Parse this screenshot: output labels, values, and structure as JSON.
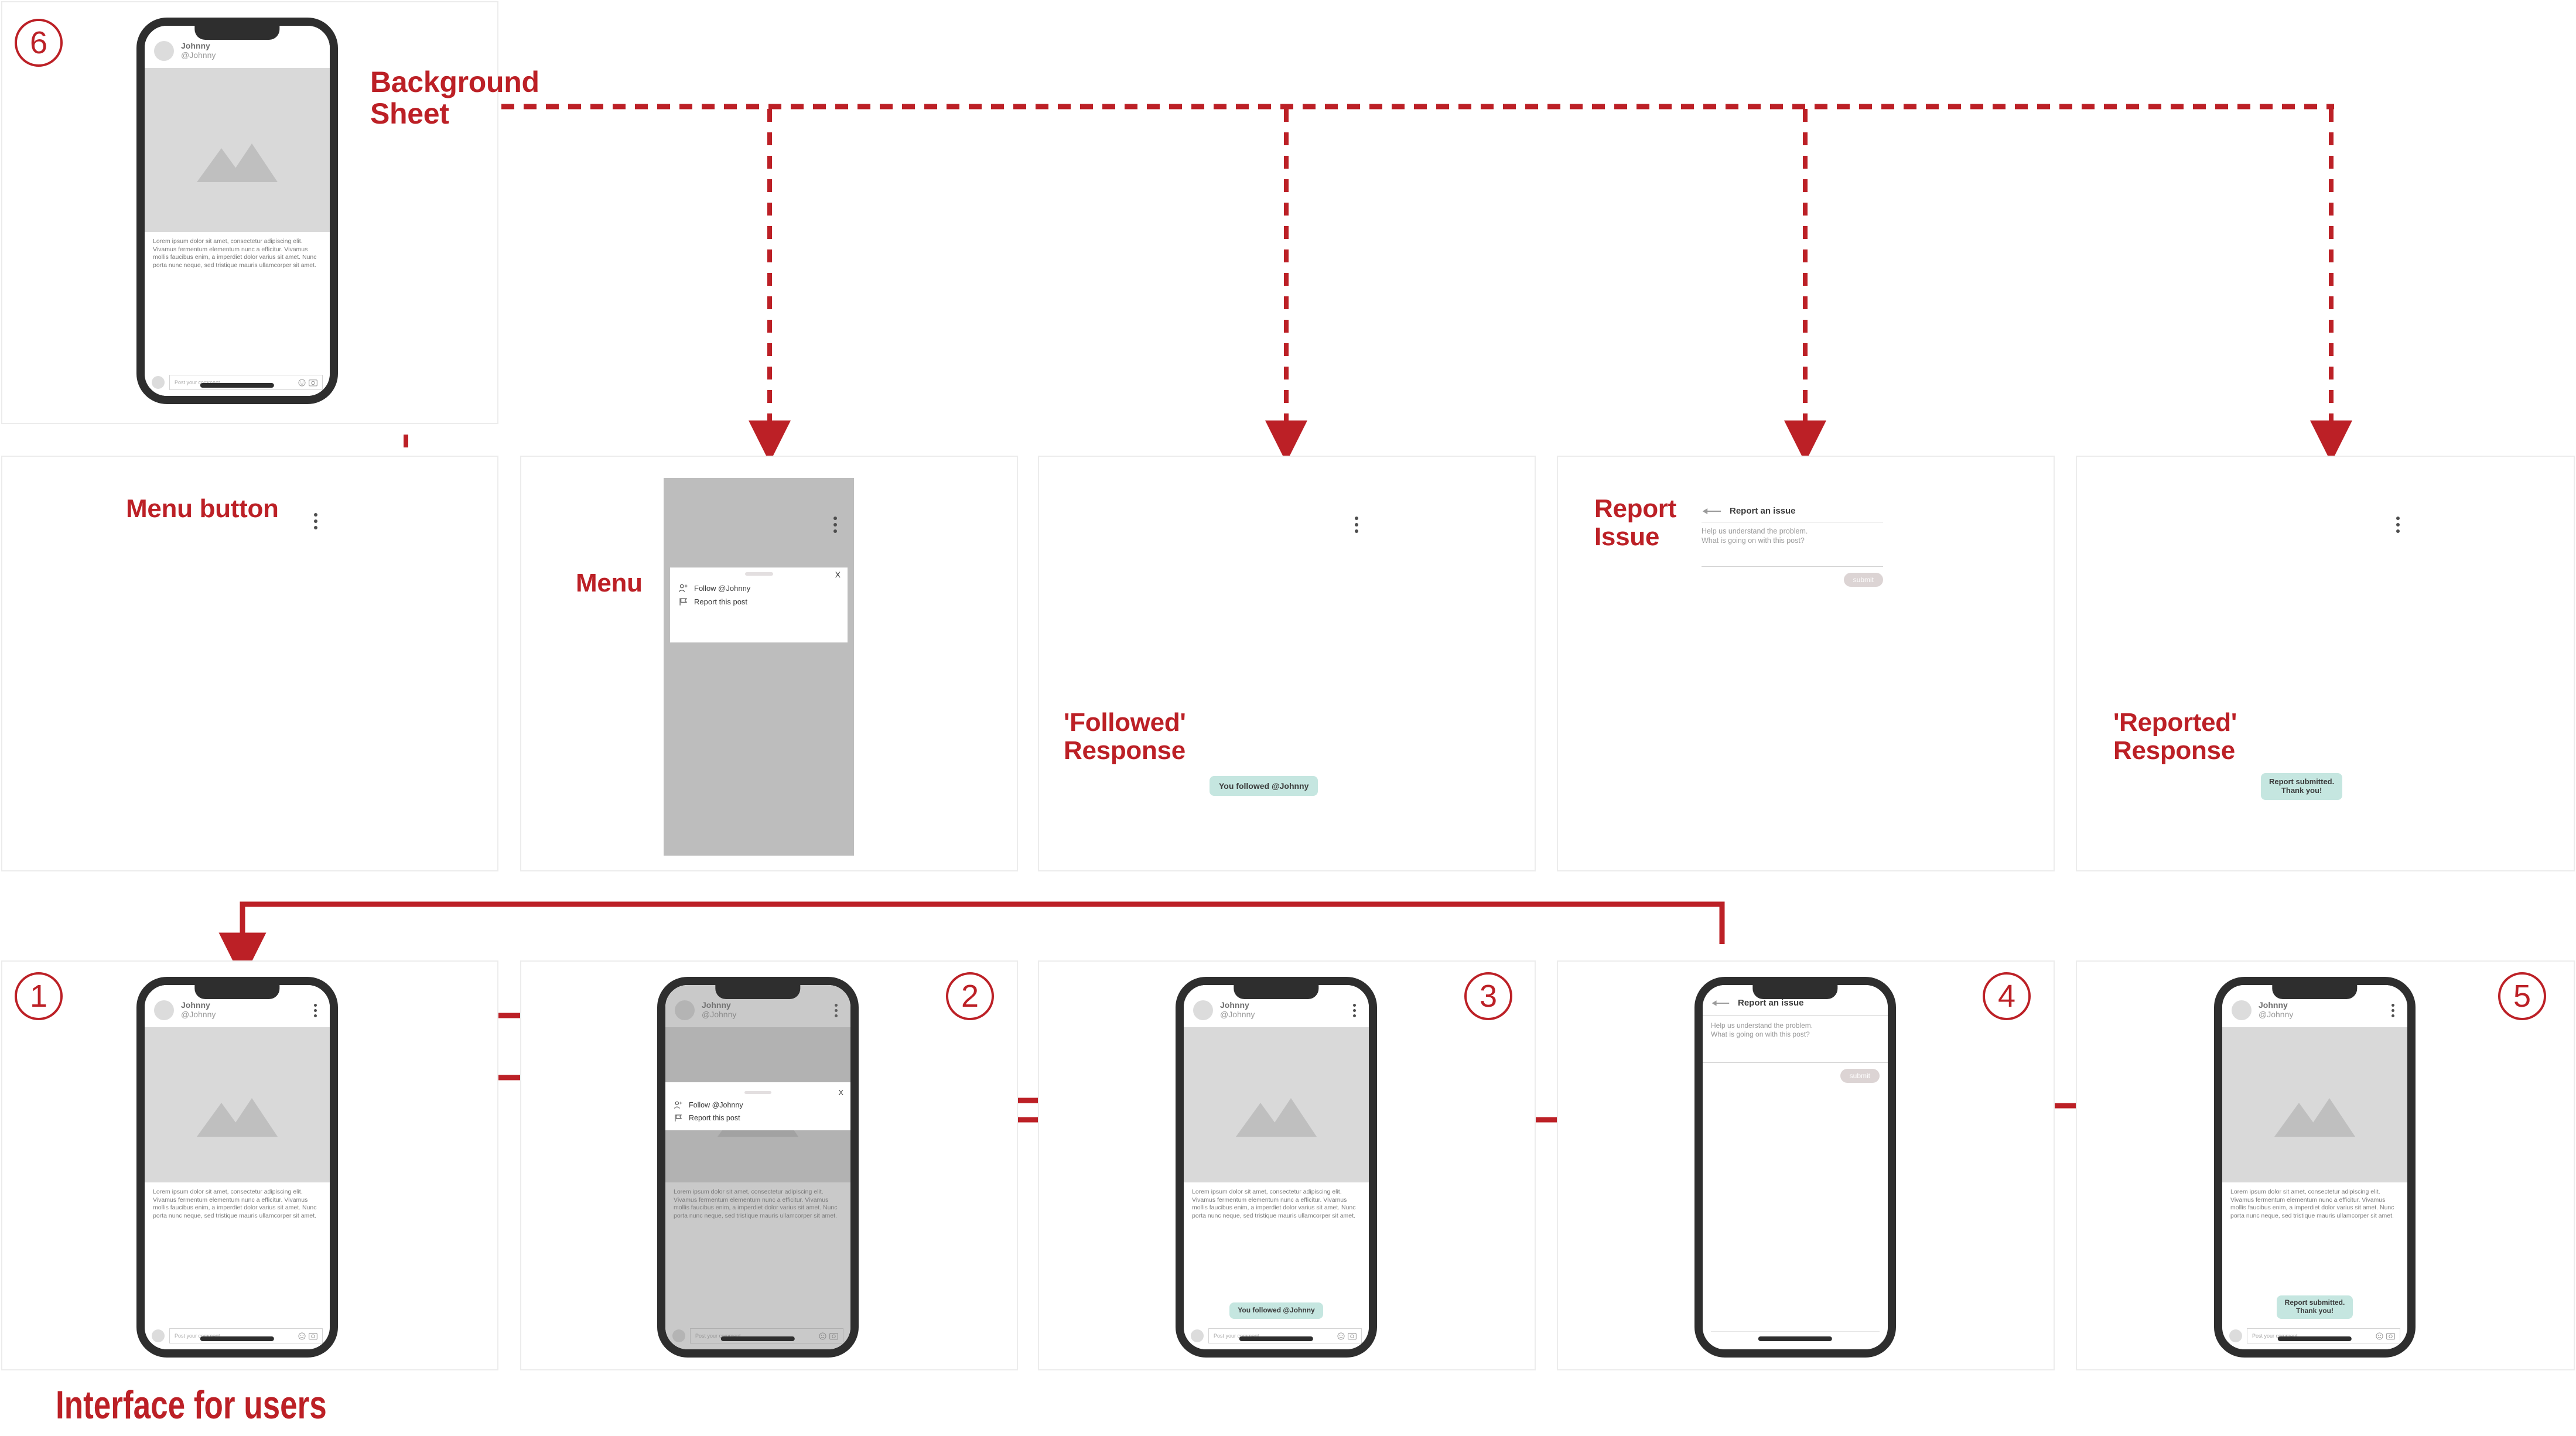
{
  "post": {
    "user_name": "Johnny",
    "user_handle": "@Johnny",
    "body": "Lorem ipsum dolor sit amet, consectetur adipiscing elit. Vivamus fermentum elementum nunc a efficitur. Vivamus mollis faucibus enim, a imperdiet dolor varius sit amet. Nunc porta nunc neque, sed tristique mauris ullamcorper sit amet.",
    "comment_placeholder": "Post your comment...",
    "emoji_icon": "emoji-icon",
    "camera_icon": "camera-icon",
    "kebab_icon": "kebab-menu-icon",
    "image_icon": "mountain-image-icon"
  },
  "menu": {
    "close_label": "X",
    "items": [
      {
        "label": "Follow @Johnny",
        "icon": "person-add-icon"
      },
      {
        "label": "Report this post",
        "icon": "flag-icon"
      }
    ]
  },
  "report": {
    "title": "Report an issue",
    "back_icon": "back-arrow-icon",
    "prompt": "Help us understand the problem.\nWhat is going on with this post?",
    "submit_label": "submit"
  },
  "toasts": {
    "followed": "You followed @Johnny",
    "reported": "Report submitted.\nThank you!"
  },
  "annotations": {
    "background_sheet": "Background\nSheet",
    "menu_button": "Menu button",
    "menu": "Menu",
    "report_issue": "Report\nIssue",
    "followed_response": "'Followed'\nResponse",
    "reported_response": "'Reported'\nResponse",
    "interface_for_users": "Interface for users"
  },
  "steps": {
    "one": "1",
    "two": "2",
    "three": "3",
    "four": "4",
    "five": "5",
    "six": "6"
  },
  "colors": {
    "accent_red": "#bc2026",
    "phone_frame": "#2e2e2e",
    "media_grey": "#d9d9d9",
    "toast_green": "#c5e6e0",
    "panel_border": "#ececec",
    "sheet_grey": "#bdbdbd"
  }
}
